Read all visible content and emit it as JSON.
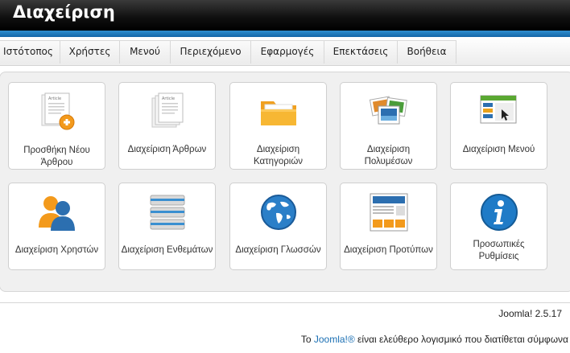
{
  "header": {
    "title": "Διαχείριση"
  },
  "menu": [
    {
      "label": "Ιστότοπος"
    },
    {
      "label": "Χρήστες"
    },
    {
      "label": "Μενού"
    },
    {
      "label": "Περιεχόμενο"
    },
    {
      "label": "Εφαρμογές"
    },
    {
      "label": "Επεκτάσεις"
    },
    {
      "label": "Βοήθεια"
    }
  ],
  "quickicons": [
    {
      "label": "Προσθήκη Νέου Άρθρου",
      "icon": "add-article-icon"
    },
    {
      "label": "Διαχείριση Άρθρων",
      "icon": "articles-icon"
    },
    {
      "label": "Διαχείριση Κατηγοριών",
      "icon": "folder-icon"
    },
    {
      "label": "Διαχείριση Πολυμέσων",
      "icon": "media-icon"
    },
    {
      "label": "Διαχείριση Μενού",
      "icon": "menu-window-icon"
    },
    {
      "label": "Διαχείριση Χρηστών",
      "icon": "users-icon"
    },
    {
      "label": "Διαχείριση Ενθεμάτων",
      "icon": "modules-icon"
    },
    {
      "label": "Διαχείριση Γλωσσών",
      "icon": "globe-icon"
    },
    {
      "label": "Διαχείριση Προτύπων",
      "icon": "template-icon"
    },
    {
      "label": "Προσωπικές Ρυθμίσεις",
      "icon": "info-icon"
    }
  ],
  "footer": {
    "version": "Joomla! 2.5.17",
    "text_prefix": "Το",
    "link": "Joomla!®",
    "text_suffix": "είναι ελεύθερο λογισμικό που διατίθεται σύμφωνα"
  },
  "colors": {
    "accent": "#1466a8",
    "link": "#1a6fb3"
  }
}
